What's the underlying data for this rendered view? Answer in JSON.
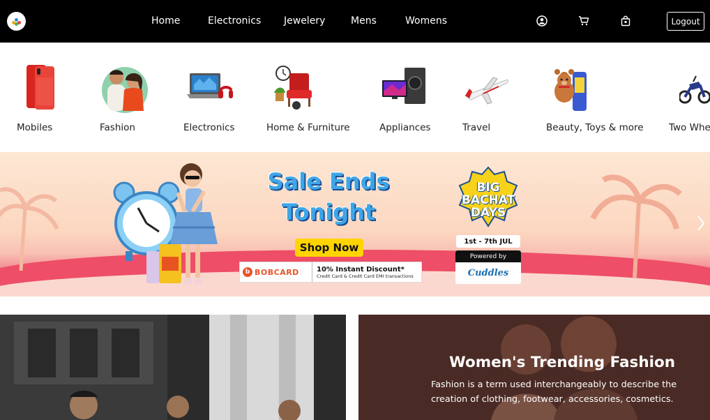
{
  "navbar": {
    "links": [
      "Home",
      "Electronics",
      "Jewelery",
      "Mens",
      "Womens"
    ],
    "logout_label": "Logout",
    "icons": [
      "user-icon",
      "cart-icon",
      "shopping-bag-icon"
    ]
  },
  "categories": [
    {
      "label": "Mobiles"
    },
    {
      "label": "Fashion"
    },
    {
      "label": "Electronics"
    },
    {
      "label": "Home & Furniture"
    },
    {
      "label": "Appliances"
    },
    {
      "label": "Travel"
    },
    {
      "label": "Beauty, Toys & more"
    },
    {
      "label": "Two Whe"
    }
  ],
  "banner": {
    "title_line1": "Sale Ends",
    "title_line2": "Tonight",
    "cta": "Shop Now",
    "bank_logo": "BOBCARD",
    "bank_offer": "10% Instant Discount*",
    "bank_offer_sub": "Credit Card & Credit Card EMI transactions",
    "event_line1": "BIG",
    "event_line2": "BACHAT",
    "event_line3": "DAYS",
    "dates": "1st - 7th JUL",
    "powered_by": "Powered by",
    "sponsor": "Cuddles"
  },
  "promo": {
    "title": "Women's Trending Fashion",
    "description": "Fashion is a term used interchangeably to describe the creation of clothing, footwear, accessories, cosmetics."
  },
  "colors": {
    "nav_bg": "#000000",
    "banner_cta": "#ffd400",
    "banner_wave": "#ee4e67"
  }
}
